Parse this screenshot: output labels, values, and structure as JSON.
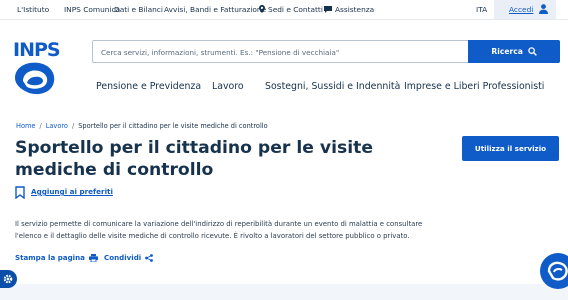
{
  "topbar": {
    "links": [
      "L'Istituto",
      "INPS Comunica",
      "Dati e Bilanci",
      "Avvisi, Bandi e Fatturazione",
      "Sedi e Contatti",
      "Assistenza"
    ],
    "language": "ITA",
    "login_label": "Accedi"
  },
  "header": {
    "logo_text": "INPS",
    "search_placeholder": "Cerca servizi, informazioni, strumenti. Es.: \"Pensione di vecchiaia\"",
    "search_button": "Ricerca"
  },
  "nav": {
    "items": [
      "Pensione e Previdenza",
      "Lavoro",
      "Sostegni, Sussidi e Indennità",
      "Imprese e Liberi Professionisti"
    ]
  },
  "breadcrumb": {
    "home": "Home",
    "section": "Lavoro",
    "current": "Sportello per il cittadino per le visite mediche di controllo"
  },
  "page": {
    "title": "Sportello per il cittadino per le visite mediche di controllo",
    "favorite_label": "Aggiungi ai preferiti",
    "service_button": "Utilizza il servizio",
    "description": "Il servizio permette di comunicare la variazione dell'indirizzo di reperibilità durante un evento di malattia e consultare l'elenco e il dettaglio delle visite mediche di controllo ricevute. È rivolto a lavoratori del settore pubblico o privato.",
    "print_label": "Stampa la pagina",
    "share_label": "Condividi"
  },
  "icons": {
    "location": "map-pin-icon",
    "assistance": "chat-icon",
    "user": "user-icon",
    "search": "search-icon",
    "bookmark": "bookmark-icon",
    "print": "printer-icon",
    "share": "share-icon",
    "settings": "gear-icon"
  },
  "colors": {
    "primary": "#0f5bc8",
    "text_dark": "#17324d"
  }
}
